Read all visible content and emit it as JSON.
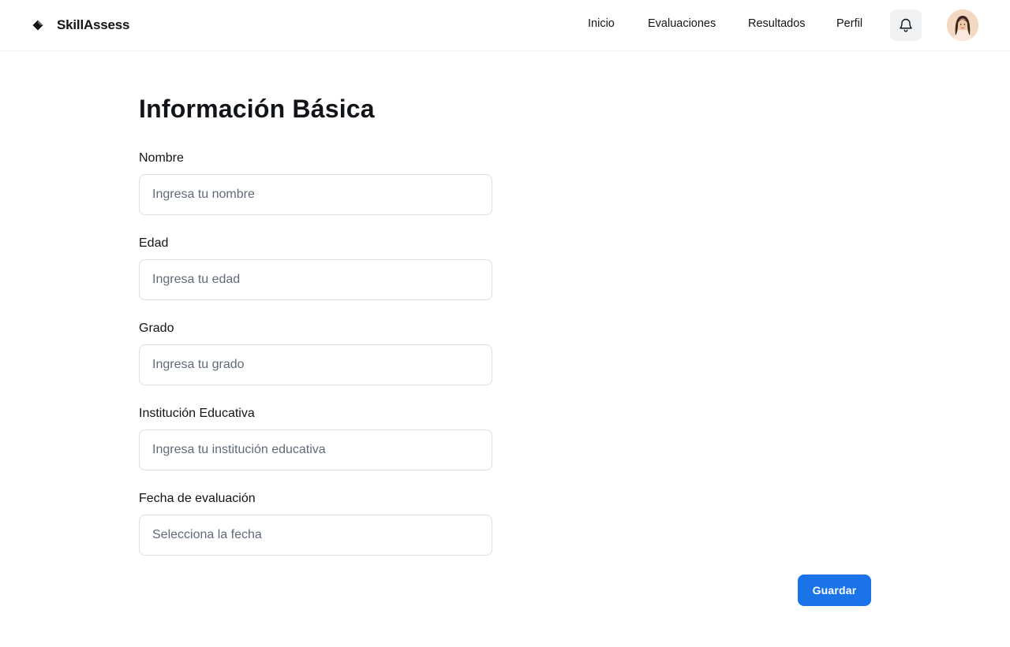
{
  "app": {
    "brand_name": "SkillAssess",
    "icons": {
      "logo": "diamond-logo-icon",
      "bell": "bell-icon"
    }
  },
  "nav": {
    "items": [
      {
        "label": "Inicio"
      },
      {
        "label": "Evaluaciones"
      },
      {
        "label": "Resultados"
      },
      {
        "label": "Perfil"
      }
    ]
  },
  "form": {
    "title": "Información Básica",
    "fields": [
      {
        "label": "Nombre",
        "value": "",
        "placeholder": "Ingresa tu nombre"
      },
      {
        "label": "Edad",
        "value": "",
        "placeholder": "Ingresa tu edad"
      },
      {
        "label": "Grado",
        "value": "",
        "placeholder": "Ingresa tu grado"
      },
      {
        "label": "Institución Educativa",
        "value": "",
        "placeholder": "Ingresa tu institución educativa"
      },
      {
        "label": "Fecha de evaluación",
        "value": "",
        "placeholder": "Selecciona la fecha"
      }
    ],
    "save_label": "Guardar"
  },
  "colors": {
    "accent": "#1a73e8",
    "text": "#111418",
    "placeholder": "#5f6b7a",
    "border": "#dbe0e6"
  }
}
